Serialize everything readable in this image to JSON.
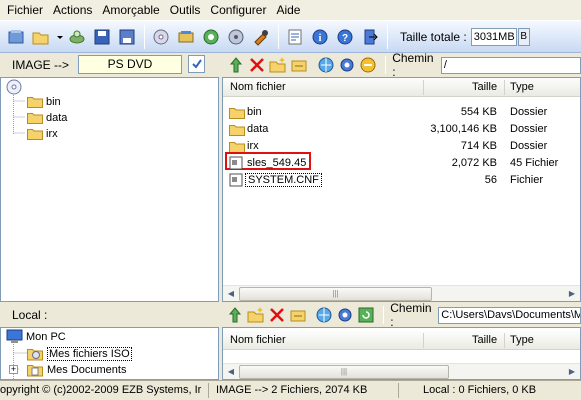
{
  "menu": [
    "Fichier",
    "Actions",
    "Amorçable",
    "Outils",
    "Configurer",
    "Aide"
  ],
  "toolbar": {
    "total_label": "Taille totale :",
    "total_value": "3031MB",
    "total_drop": "B"
  },
  "image_panel": {
    "label": "IMAGE -->",
    "disc_type": "PS DVD",
    "chemin_label": "Chemin :",
    "path": "/",
    "tree": [
      "bin",
      "data",
      "irx"
    ],
    "columns": {
      "name": "Nom fichier",
      "size": "Taille",
      "type": "Type"
    },
    "files": [
      {
        "name": "bin",
        "size": "554 KB",
        "type": "Dossier",
        "kind": "folder"
      },
      {
        "name": "data",
        "size": "3,100,146 KB",
        "type": "Dossier",
        "kind": "folder"
      },
      {
        "name": "irx",
        "size": "714 KB",
        "type": "Dossier",
        "kind": "folder"
      },
      {
        "name": "sles_549.45",
        "size": "2,072 KB",
        "type": "45 Fichier",
        "kind": "file"
      },
      {
        "name": "SYSTEM.CNF",
        "size": "56",
        "type": "Fichier",
        "kind": "file"
      }
    ]
  },
  "local_panel": {
    "label": "Local :",
    "chemin_label": "Chemin :",
    "path": "C:\\Users\\Davs\\Documents\\My",
    "tree": [
      "Mon PC",
      "Mes fichiers ISO",
      "Mes Documents"
    ],
    "columns": {
      "name": "Nom fichier",
      "size": "Taille",
      "type": "Type"
    }
  },
  "status": {
    "copyright": "opyright © (c)2002-2009 EZB Systems, Ir",
    "image_info": "IMAGE --> 2 Fichiers, 2074 KB",
    "local_info": "Local : 0 Fichiers, 0 KB"
  },
  "colors": {
    "highlight_box": "#e01010",
    "accent": "#316ac5"
  }
}
